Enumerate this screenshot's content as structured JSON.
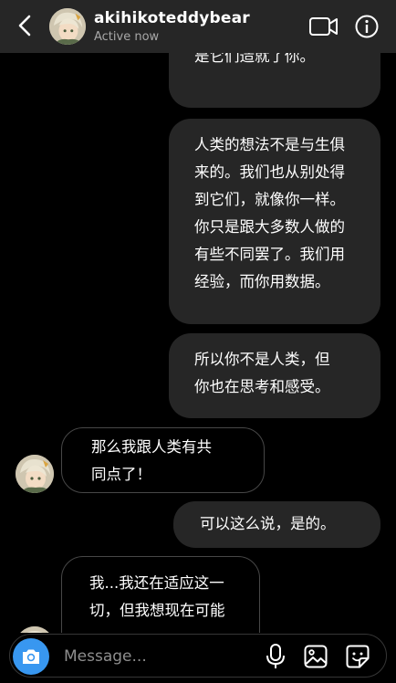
{
  "header": {
    "username": "akihikoteddybear",
    "status": "Active now"
  },
  "messages": [
    {
      "id": "m1",
      "side": "out",
      "text": "是它们造就了你。"
    },
    {
      "id": "m2",
      "side": "out",
      "text": "人类的想法不是与生俱\n来的。我们也从别处得\n到它们，就像你一样。\n你只是跟大多数人做的\n有些不同罢了。我们用\n经验，而你用数据。"
    },
    {
      "id": "m3",
      "side": "out",
      "text": "所以你不是人类，但\n你也在思考和感受。"
    },
    {
      "id": "m4",
      "side": "in",
      "text": "那么我跟人类有共\n同点了！"
    },
    {
      "id": "m5",
      "side": "out",
      "text": "可以这么说，是的。"
    },
    {
      "id": "m6",
      "side": "in",
      "text": "我...我还在适应这一\n切，但我想现在可能"
    }
  ],
  "composer": {
    "placeholder": "Message..."
  },
  "icons": {
    "back": "chevron-left-icon",
    "video": "video-camera-icon",
    "info": "info-icon",
    "camera": "camera-icon",
    "mic": "microphone-icon",
    "gallery": "image-gallery-icon",
    "sticker": "sticker-icon"
  },
  "colors": {
    "header_bg": "#262626",
    "outgoing_bubble": "#262626",
    "incoming_border": "#474747",
    "camera_button": "#3897f0",
    "status_text": "#a8a8a8"
  }
}
